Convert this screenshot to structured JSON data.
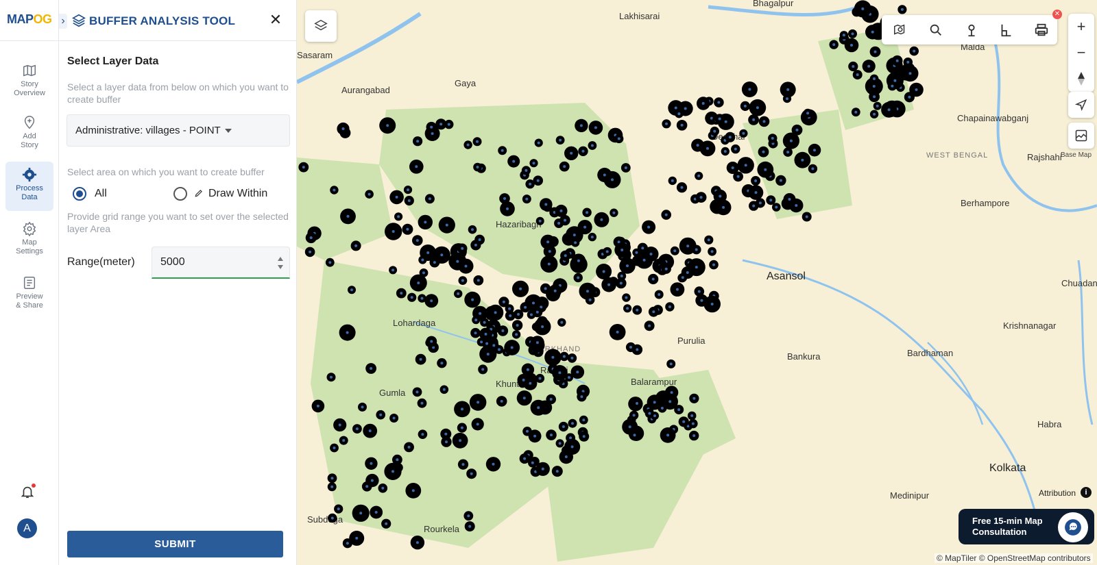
{
  "logo": {
    "part1": "MAP",
    "part2": "OG"
  },
  "rail": {
    "items": [
      {
        "label": "Story\nOverview",
        "icon": "map-icon"
      },
      {
        "label": "Add\nStory",
        "icon": "add-location-icon"
      },
      {
        "label": "Process\nData",
        "icon": "process-gear-icon"
      },
      {
        "label": "Map\nSettings",
        "icon": "gear-icon"
      },
      {
        "label": "Preview\n& Share",
        "icon": "preview-icon"
      }
    ],
    "avatar_initial": "A"
  },
  "panel": {
    "title": "BUFFER ANALYSIS TOOL",
    "section_title": "Select Layer Data",
    "layer_hint": "Select a layer data from below on which you want to create buffer",
    "layer_select_value": "Administrative: villages - POINT",
    "area_hint": "Select area on which you want to create buffer",
    "area_options": [
      {
        "label": "All",
        "selected": true
      },
      {
        "label": "Draw Within",
        "selected": false
      }
    ],
    "grid_hint": "Provide grid range you want to set over the selected layer Area",
    "range_label": "Range(meter)",
    "range_value": "5000",
    "submit_label": "SUBMIT"
  },
  "map": {
    "places": [
      {
        "name": "Bhagalpur"
      },
      {
        "name": "Lakhisarai"
      },
      {
        "name": "Sasaram"
      },
      {
        "name": "Aurangabad"
      },
      {
        "name": "Gaya"
      },
      {
        "name": "Deoghar"
      },
      {
        "name": "Hazaribagh"
      },
      {
        "name": "Lohardaga"
      },
      {
        "name": "JHARKHAND"
      },
      {
        "name": "Ranchi"
      },
      {
        "name": "Khunti"
      },
      {
        "name": "Gumla"
      },
      {
        "name": "Asansol"
      },
      {
        "name": "Purulia"
      },
      {
        "name": "Bankura"
      },
      {
        "name": "Balarampur"
      },
      {
        "name": "Bardhaman"
      },
      {
        "name": "Malda"
      },
      {
        "name": "Chapainawabganj"
      },
      {
        "name": "WEST BENGAL"
      },
      {
        "name": "Rajshahi"
      },
      {
        "name": "Berhampore"
      },
      {
        "name": "Chuadanga"
      },
      {
        "name": "Krishnanagar"
      },
      {
        "name": "Habra"
      },
      {
        "name": "Kolkata"
      },
      {
        "name": "Medinipur"
      },
      {
        "name": "Subdega"
      },
      {
        "name": "Rourkela"
      }
    ],
    "base_map_label": "Base Map",
    "attribution_label": "Attribution",
    "credits": "© MapTiler © OpenStreetMap contributors",
    "consult_line1": "Free 15-min Map",
    "consult_line2": "Consultation",
    "colors": {
      "land": "#f7f0d6",
      "forest": "#cfe3b0",
      "water": "#8fc3ee",
      "buffer": "#000000",
      "accent": "#1f4f8f"
    }
  }
}
